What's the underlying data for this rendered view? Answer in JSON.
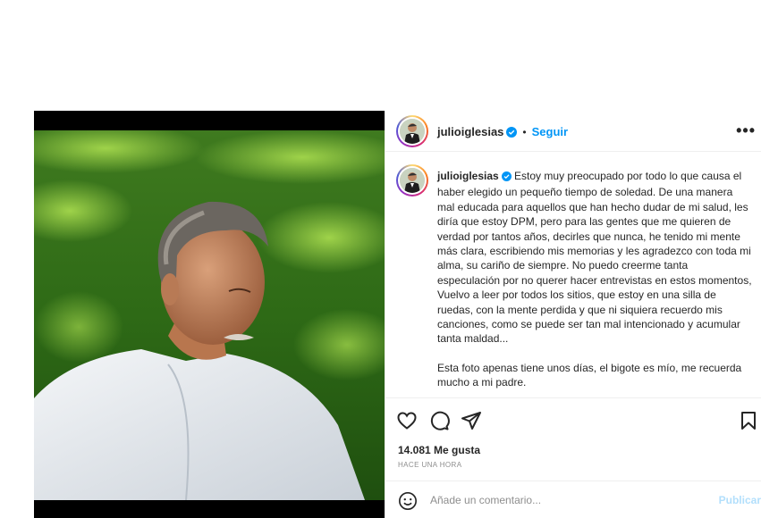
{
  "post": {
    "username": "julioiglesias",
    "follow_label": "Seguir",
    "separator": "•",
    "more_label": "•••",
    "caption_paragraph_1": "Estoy muy preocupado por todo lo que causa el haber elegido un pequeño tiempo de soledad. De una manera mal educada para aquellos que han hecho dudar de mi salud, les diría que estoy DPM, pero para las gentes que me quieren de verdad por tantos años, decirles que nunca, he tenido mi mente más clara, escribiendo mis memorias y les agradezco con toda mi alma, su cariño de siempre. No puedo creerme tanta especulación por no querer hacer entrevistas en estos momentos, Vuelvo a leer por todos los sitios, que estoy en una silla de ruedas, con la mente perdida y que ni siquiera recuerdo mis canciones, como se puede ser tan mal intencionado y acumular tanta maldad...",
    "caption_paragraph_2": "Esta foto apenas tiene unos días, el bigote es mío, me recuerda mucho a mi padre.",
    "likes": "14.081 Me gusta",
    "time_ago": "HACE UNA HORA",
    "comment_placeholder": "Añade un comentario...",
    "publish_label": "Publicar"
  },
  "icons": {
    "like": "heart-icon",
    "comment": "comment-icon",
    "share": "share-icon",
    "save": "bookmark-icon",
    "emoji": "emoji-icon",
    "verified": "verified-badge-icon",
    "more": "more-options-icon"
  },
  "colors": {
    "link_blue": "#0095f6",
    "publish_disabled": "#b2dffc",
    "text": "#262626",
    "muted": "#8e8e8e",
    "divider": "#efefef"
  }
}
